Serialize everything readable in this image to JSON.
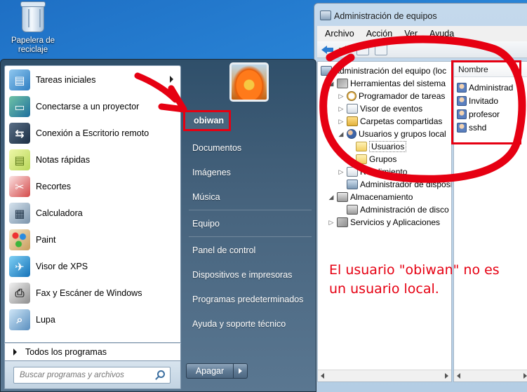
{
  "desktop": {
    "recycle_bin_label": "Papelera de reciclaje"
  },
  "start_menu": {
    "programs": [
      {
        "label": "Tareas iniciales",
        "icon": "getting-started-icon",
        "has_submenu": true
      },
      {
        "label": "Conectarse a un proyector",
        "icon": "projector-icon"
      },
      {
        "label": "Conexión a Escritorio remoto",
        "icon": "remote-desktop-icon"
      },
      {
        "label": "Notas rápidas",
        "icon": "sticky-notes-icon"
      },
      {
        "label": "Recortes",
        "icon": "snipping-tool-icon"
      },
      {
        "label": "Calculadora",
        "icon": "calculator-icon"
      },
      {
        "label": "Paint",
        "icon": "paint-icon"
      },
      {
        "label": "Visor de XPS",
        "icon": "xps-viewer-icon"
      },
      {
        "label": "Fax y Escáner de Windows",
        "icon": "fax-scan-icon"
      },
      {
        "label": "Lupa",
        "icon": "magnifier-icon"
      }
    ],
    "all_programs": "Todos los programas",
    "search_placeholder": "Buscar programas y archivos",
    "right_items": {
      "user": "obiwan",
      "documents": "Documentos",
      "images": "Imágenes",
      "music": "Música",
      "computer": "Equipo",
      "control_panel": "Panel de control",
      "devices": "Dispositivos e impresoras",
      "default_programs": "Programas predeterminados",
      "help": "Ayuda y soporte técnico"
    },
    "shutdown_label": "Apagar"
  },
  "computer_management": {
    "title": "Administración de equipos",
    "menu": [
      "Archivo",
      "Acción",
      "Ver",
      "Ayuda"
    ],
    "tree": {
      "root": "Administración del equipo (loc",
      "system_tools": "Herramientas del sistema",
      "task_scheduler": "Programador de tareas",
      "event_viewer": "Visor de eventos",
      "shared_folders": "Carpetas compartidas",
      "local_users_groups": "Usuarios y grupos local",
      "users": "Usuarios",
      "groups": "Grupos",
      "performance": "Rendimiento",
      "device_manager": "Administrador de dispositivos",
      "storage": "Almacenamiento",
      "disk_management": "Administración de disco",
      "services_apps": "Servicios y Aplicaciones"
    },
    "list_header": "Nombre",
    "users": [
      "Administrad",
      "Invitado",
      "profesor",
      "sshd"
    ]
  },
  "annotation": {
    "text_line1": "El usuario \"obiwan\" no es",
    "text_line2": "un usuario local.",
    "color": "#e60012"
  }
}
